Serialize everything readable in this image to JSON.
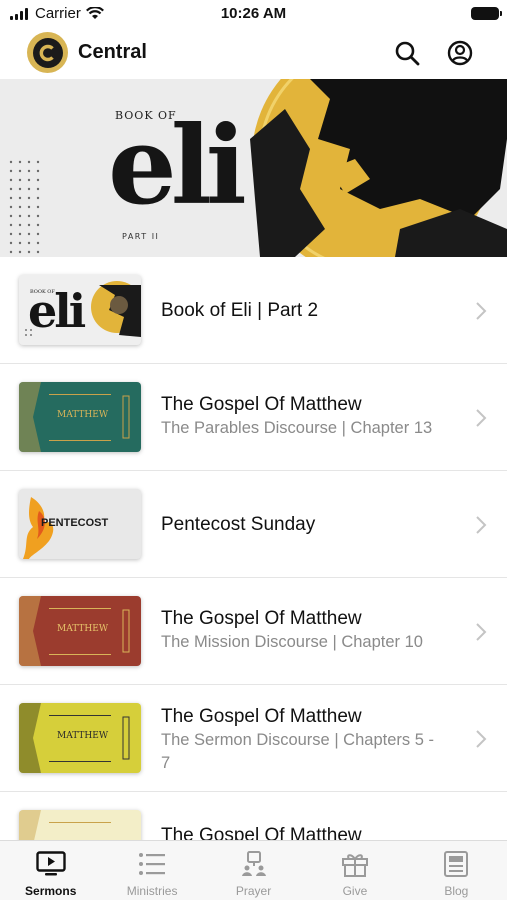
{
  "status_bar": {
    "carrier": "Carrier",
    "time": "10:26 AM"
  },
  "header": {
    "title": "Central"
  },
  "hero": {
    "text_top": "BOOK OF",
    "text_main": "eli",
    "text_part": "PART II"
  },
  "sermons": [
    {
      "title": "Book of Eli | Part 2",
      "subtitle": ""
    },
    {
      "title": "The Gospel Of Matthew",
      "subtitle": "The Parables Discourse | Chapter 13"
    },
    {
      "title": "Pentecost Sunday",
      "subtitle": ""
    },
    {
      "title": "The Gospel Of Matthew",
      "subtitle": "The Mission Discourse | Chapter 10"
    },
    {
      "title": "The Gospel Of Matthew",
      "subtitle": "The Sermon Discourse | Chapters 5 - 7"
    },
    {
      "title": "The Gospel Of Matthew",
      "subtitle": ""
    }
  ],
  "thumbs": {
    "eli_text": "eli",
    "eli_top": "BOOK OF",
    "pentecost_text": "PENTECOST",
    "matthew_text": "MATTHEW"
  },
  "tabs": [
    {
      "label": "Sermons",
      "icon": "tv-play-icon",
      "active": true
    },
    {
      "label": "Ministries",
      "icon": "list-icon",
      "active": false
    },
    {
      "label": "Prayer",
      "icon": "prayer-icon",
      "active": false
    },
    {
      "label": "Give",
      "icon": "gift-icon",
      "active": false
    },
    {
      "label": "Blog",
      "icon": "newspaper-icon",
      "active": false
    }
  ],
  "colors": {
    "accent_gold": "#d8b554",
    "teal": "#256b5f",
    "red": "#9b3c2e",
    "yellow": "#d6cf3a"
  }
}
